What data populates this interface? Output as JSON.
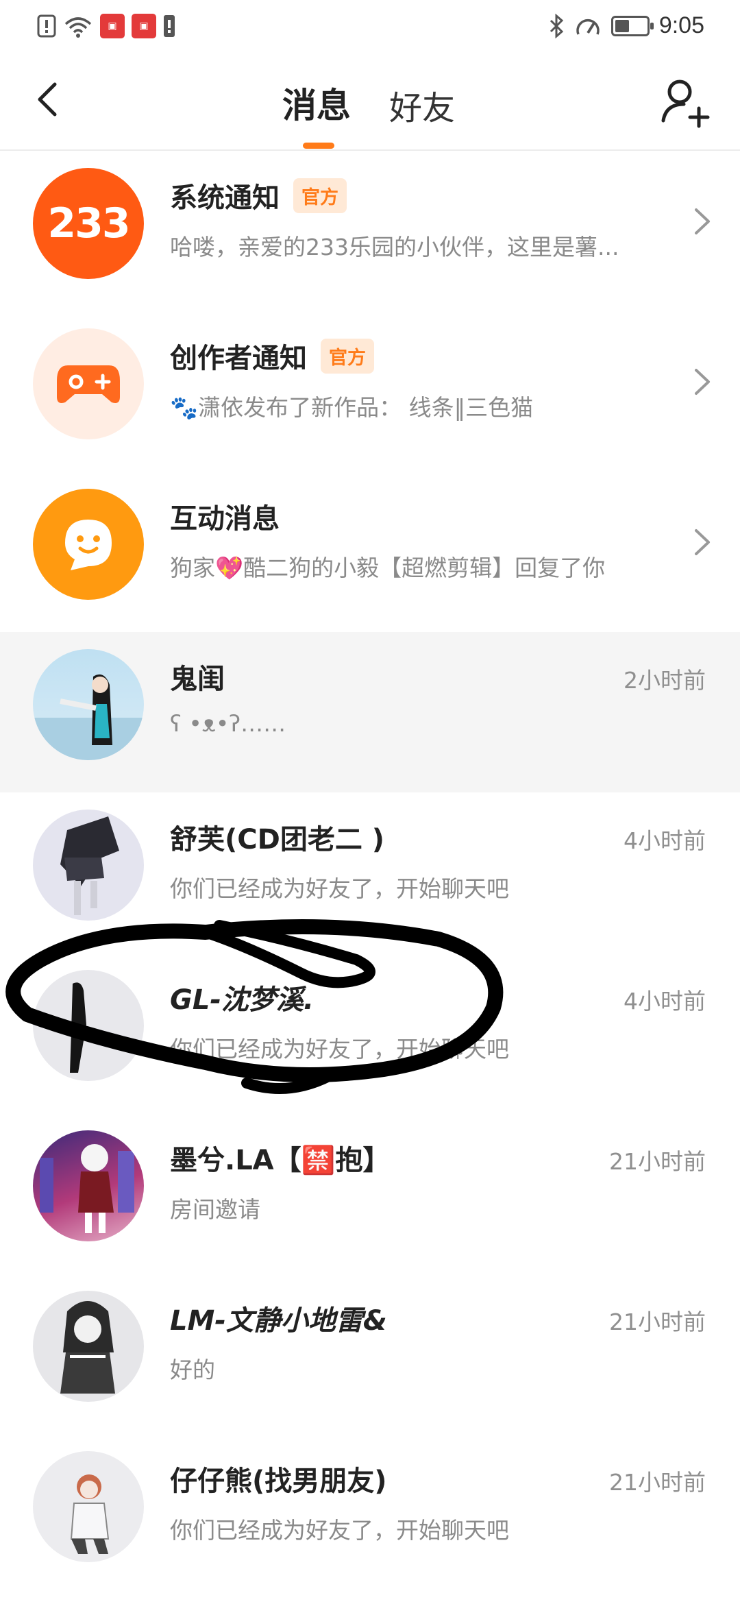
{
  "status_bar": {
    "time": "9:05",
    "icons": [
      "alert-icon",
      "wifi-icon",
      "app-notification-icon",
      "app-notification-icon",
      "sim-icon",
      "bluetooth-icon",
      "speed-icon",
      "battery-icon"
    ],
    "battery_level": 0.45
  },
  "header": {
    "tabs": [
      {
        "label": "消息",
        "active": true
      },
      {
        "label": "好友",
        "active": false
      }
    ],
    "accent_color": "#ff7b19"
  },
  "messages": [
    {
      "title": "系统通知",
      "badge": "官方",
      "subtitle": "哈喽，亲爱的233乐园的小伙伴，这里是薯...",
      "avatar_text": "233",
      "avatar_icon": "logo-233-icon"
    },
    {
      "title": "创作者通知",
      "badge": "官方",
      "subtitle": "🐾潇依发布了新作品：  线条‖三色猫",
      "avatar_icon": "gamepad-icon"
    },
    {
      "title": "互动消息",
      "subtitle": "狗家💖酷二狗的小毅【超燃剪辑】回复了你",
      "avatar_icon": "chat-bubble-face-icon"
    },
    {
      "title": "鬼闺",
      "subtitle": "ʕ •ᴥ•ʔ……",
      "time": "2小时前"
    },
    {
      "title": "舒芙(CD团老二 )",
      "subtitle": "你们已经成为好友了，开始聊天吧",
      "time": "4小时前"
    },
    {
      "title": "GL-沈梦溪.",
      "subtitle": "你们已经成为好友了，开始聊天吧",
      "time": "4小时前"
    },
    {
      "title": "墨兮.LA【🈲抱】",
      "subtitle": "房间邀请",
      "time": "21小时前"
    },
    {
      "title": "LM-文静小地雷&",
      "subtitle": "好的",
      "time": "21小时前"
    },
    {
      "title": "仔仔熊(找男朋友)",
      "subtitle": "你们已经成为好友了，开始聊天吧",
      "time": "21小时前"
    }
  ]
}
